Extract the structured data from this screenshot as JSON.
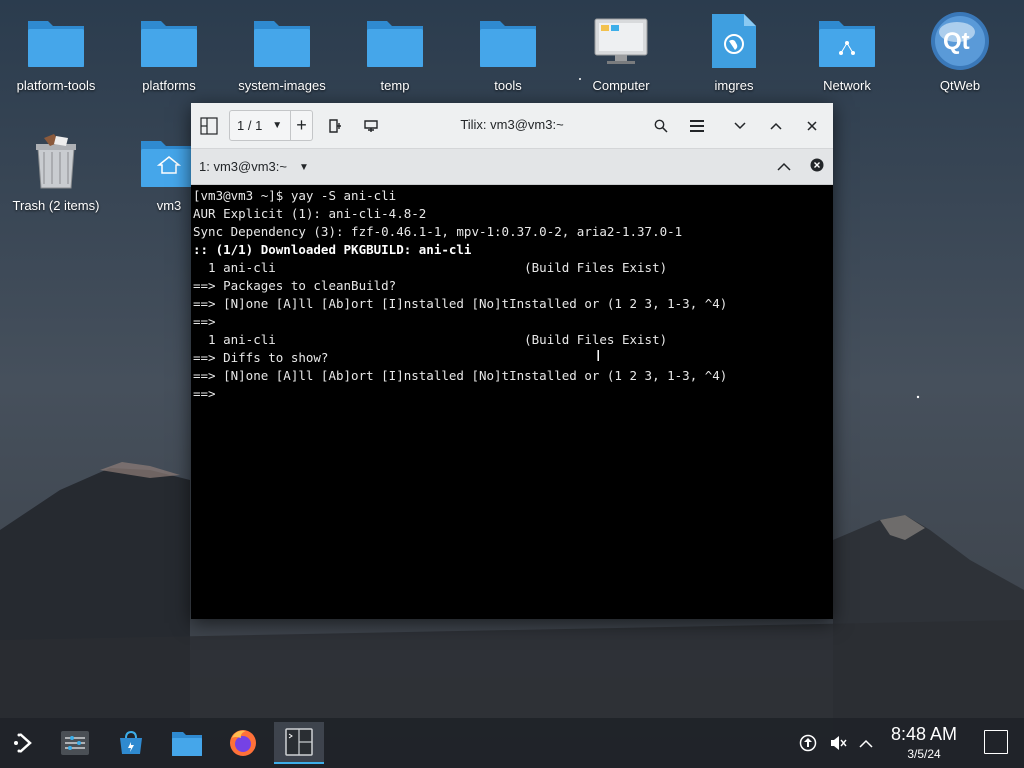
{
  "desktop": {
    "icons": [
      {
        "label": "platform-tools",
        "icon": "folder-icon"
      },
      {
        "label": "platforms",
        "icon": "folder-icon"
      },
      {
        "label": "system-images",
        "icon": "folder-icon"
      },
      {
        "label": "temp",
        "icon": "folder-icon"
      },
      {
        "label": "tools",
        "icon": "folder-icon"
      },
      {
        "label": "Computer",
        "icon": "computer-icon"
      },
      {
        "label": "imgres",
        "icon": "web-file-icon"
      },
      {
        "label": "Network",
        "icon": "network-folder-icon"
      },
      {
        "label": "QtWeb",
        "icon": "qt-logo-icon"
      },
      {
        "label": "Trash (2 items)",
        "icon": "trash-icon"
      },
      {
        "label": "vm3",
        "icon": "home-folder-icon"
      }
    ]
  },
  "window": {
    "title": "Tilix: vm3@vm3:~",
    "session_selector": "1 / 1",
    "add_label": "+",
    "tab_label": "1: vm3@vm3:~",
    "terminal_lines": [
      {
        "text": "[vm3@vm3 ~]$ yay -S ani-cli",
        "bold": false
      },
      {
        "text": "AUR Explicit (1): ani-cli-4.8-2",
        "bold": false
      },
      {
        "text": "Sync Dependency (3): fzf-0.46.1-1, mpv-1:0.37.0-2, aria2-1.37.0-1",
        "bold": false
      },
      {
        "text": ":: (1/1) Downloaded PKGBUILD: ani-cli",
        "bold": true
      },
      {
        "text": "  1 ani-cli                                 (Build Files Exist)",
        "bold": false
      },
      {
        "text": "==> Packages to cleanBuild?",
        "bold": false
      },
      {
        "text": "==> [N]one [A]ll [Ab]ort [I]nstalled [No]tInstalled or (1 2 3, 1-3, ^4)",
        "bold": false
      },
      {
        "text": "==>",
        "bold": false
      },
      {
        "text": "  1 ani-cli                                 (Build Files Exist)",
        "bold": false
      },
      {
        "text": "==> Diffs to show?",
        "bold": false
      },
      {
        "text": "==> [N]one [A]ll [Ab]ort [I]nstalled [No]tInstalled or (1 2 3, 1-3, ^4)",
        "bold": false
      },
      {
        "text": "==>",
        "bold": false
      }
    ]
  },
  "taskbar": {
    "apps": [
      {
        "name": "application-launcher-icon"
      },
      {
        "name": "system-settings-icon"
      },
      {
        "name": "discover-store-icon"
      },
      {
        "name": "dolphin-file-manager-icon"
      },
      {
        "name": "firefox-icon"
      },
      {
        "name": "tilix-terminal-icon",
        "active": true
      }
    ],
    "clock": {
      "time": "8:48 AM",
      "date": "3/5/24"
    }
  },
  "colors": {
    "accent": "#3daee9",
    "folder": "#3f9fe0",
    "terminal_bg": "#000000",
    "titlebar_bg": "#eef0f1"
  }
}
